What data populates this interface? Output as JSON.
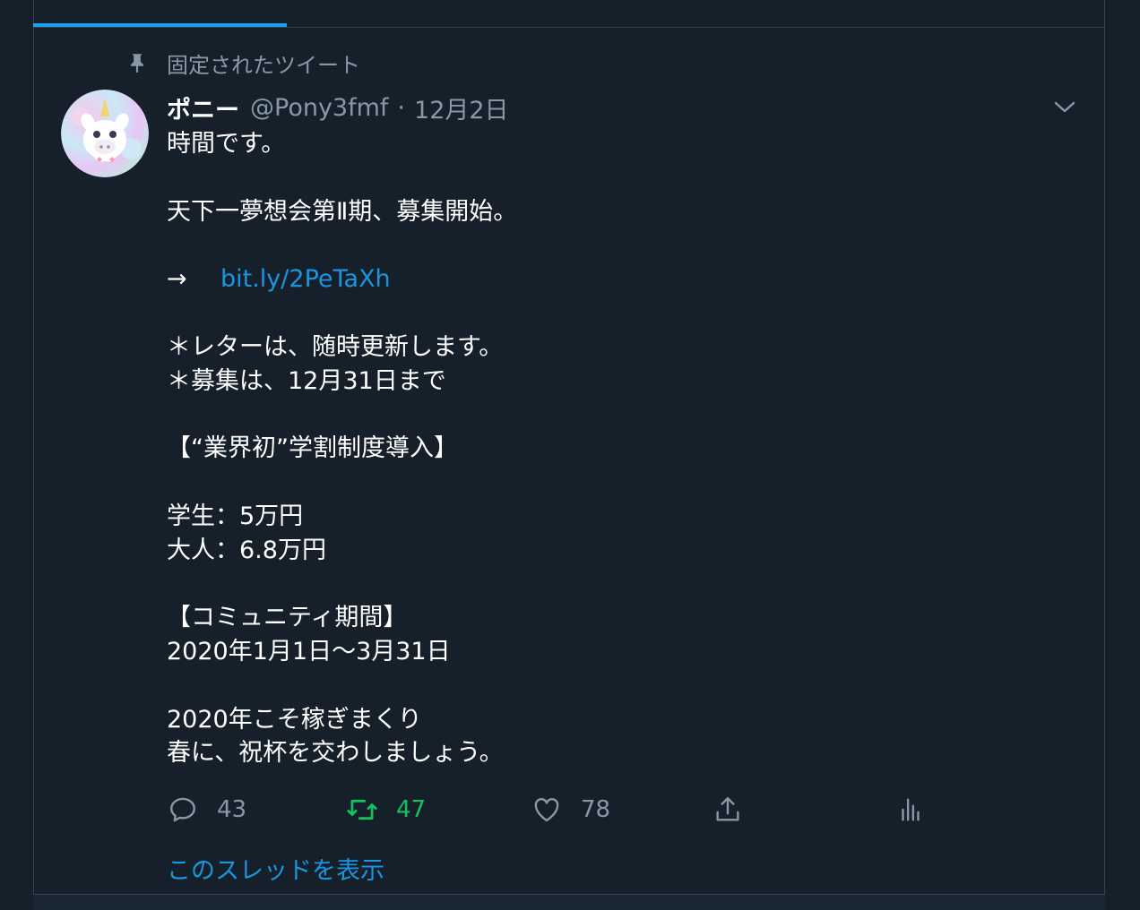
{
  "pinned": {
    "label": "固定されたツイート"
  },
  "tweet": {
    "display_name": "ポニー",
    "handle": "@Pony3fmf",
    "separator": "·",
    "date": "12月2日",
    "lines": {
      "l1": "時間です。",
      "l2": "天下一夢想会第Ⅱ期、募集開始。",
      "l3_arrow": "→",
      "l3_link": "bit.ly/2PeTaXh",
      "l4": "＊レターは、随時更新します。",
      "l5": "＊募集は、12月31日まで",
      "l6": "【“業界初”学割制度導入】",
      "l7": "学生：5万円",
      "l8": "大人：6.8万円",
      "l9": "【コミュニティ期間】",
      "l10": "2020年1月1日〜3月31日",
      "l11": "2020年こそ稼ぎまくり",
      "l12": "春に、祝杯を交わしましょう。"
    },
    "actions": {
      "reply_count": "43",
      "retweet_count": "47",
      "like_count": "78"
    },
    "show_thread": "このスレッドを表示"
  },
  "colors": {
    "background": "#15202b",
    "border": "#38444d",
    "secondary_text": "#8899a6",
    "link": "#1b95e0",
    "retweet_active": "#17bf63",
    "accent_tab": "#1da1f2"
  },
  "icons": [
    "pin-icon",
    "avatar-unicorn",
    "chevron-down-icon",
    "reply-icon",
    "retweet-icon",
    "like-icon",
    "share-icon",
    "analytics-icon"
  ]
}
